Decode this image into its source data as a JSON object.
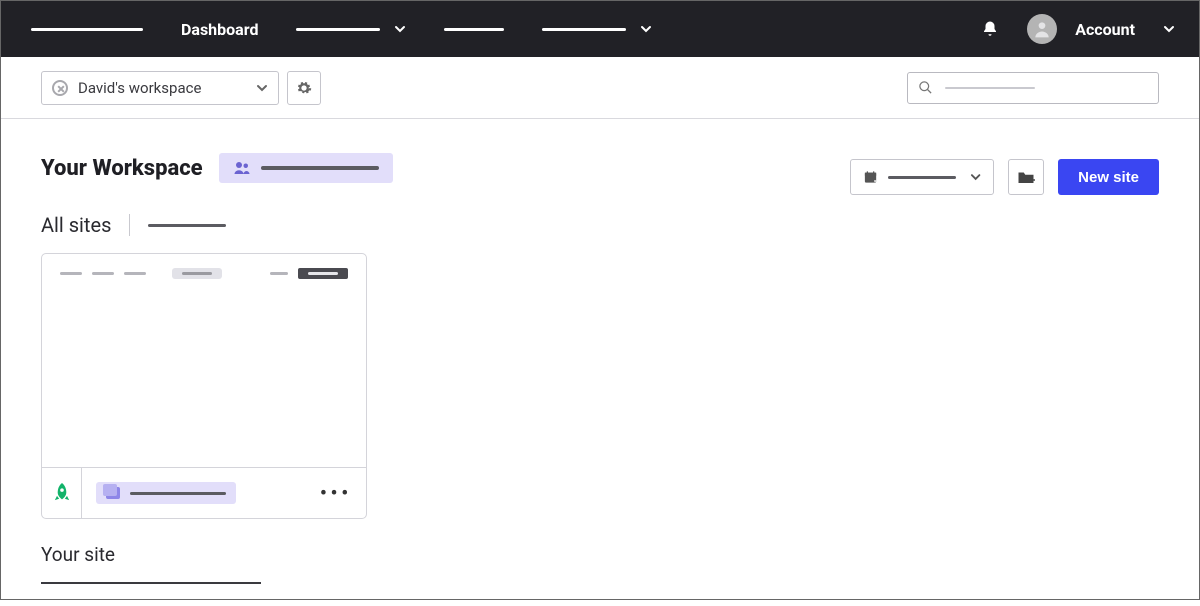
{
  "nav": {
    "dashboard_label": "Dashboard",
    "account_label": "Account"
  },
  "subbar": {
    "workspace_name": "David's workspace"
  },
  "main": {
    "workspace_heading": "Your Workspace",
    "all_sites_heading": "All sites",
    "new_site_label": "New site",
    "your_site_heading": "Your site"
  }
}
